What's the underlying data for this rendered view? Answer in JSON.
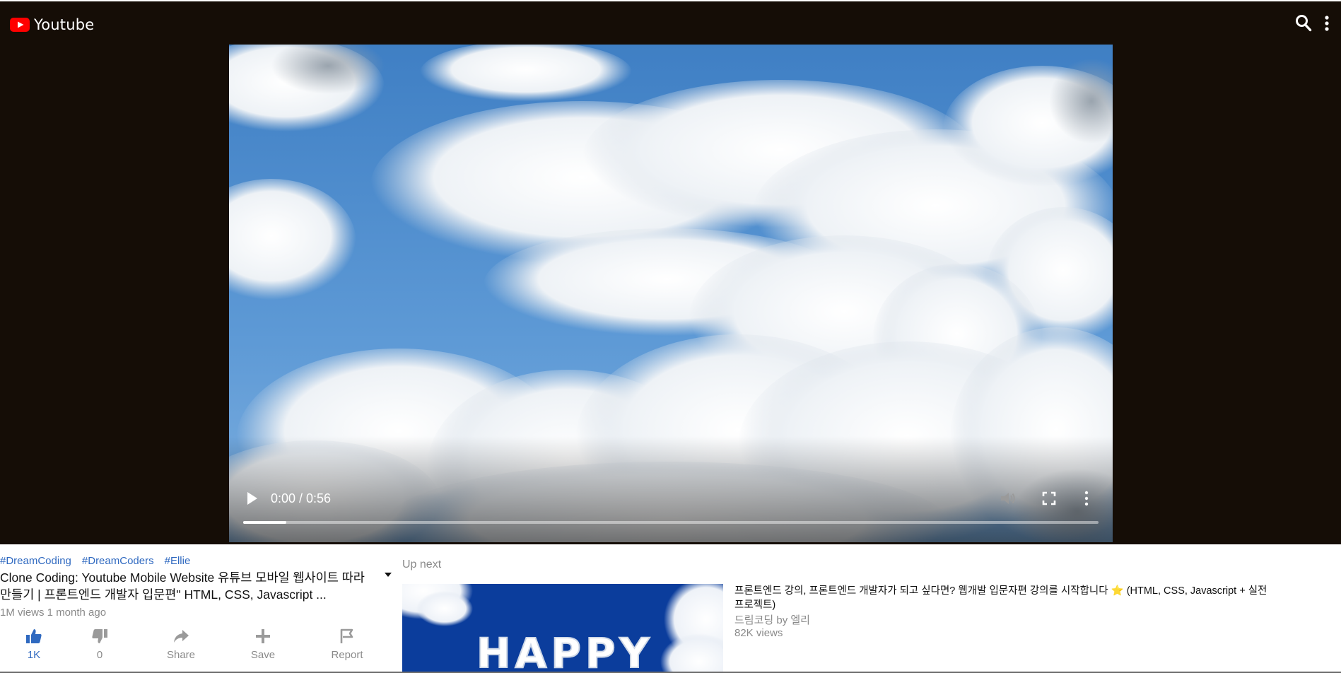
{
  "header": {
    "brand": "Youtube",
    "colors": {
      "background": "#150d06",
      "brand_red": "#ff0000",
      "link": "#2f69c0"
    },
    "icons": {
      "logo": "youtube-logo-icon",
      "search": "search-icon",
      "menu": "more-vertical-icon"
    }
  },
  "player": {
    "time": "0:00 / 0:56",
    "buffered": 0.05,
    "icons": [
      "play-icon",
      "volume-icon",
      "fullscreen-icon",
      "more-vertical-icon"
    ]
  },
  "info": {
    "tags": [
      "#DreamCoding",
      "#DreamCoders",
      "#Ellie"
    ],
    "title": "Clone Coding: Youtube Mobile Website 유튜브 모바일 웹사이트 따라 만들기 | 프론트엔드 개발자 입문편\" HTML, CSS, Javascript ...",
    "meta": "1M views 1 month ago",
    "actions": [
      {
        "icon": "thumbs-up-icon",
        "label": "1K"
      },
      {
        "icon": "thumbs-down-icon",
        "label": "0"
      },
      {
        "icon": "share-icon",
        "label": "Share"
      },
      {
        "icon": "plus-icon",
        "label": "Save"
      },
      {
        "icon": "flag-icon",
        "label": "Report"
      }
    ]
  },
  "upnext": {
    "label": "Up next",
    "items": [
      {
        "thumbnail_text": "HAPPY",
        "title": "프론트엔드 강의, 프론트엔드 개발자가 되고 싶다면? 웹개발 입문자편 강의를 시작합니다 ⭐ (HTML, CSS, Javascript + 실전 프로젝트)",
        "channel": "드림코딩 by 엘리",
        "views": "82K views"
      }
    ]
  }
}
